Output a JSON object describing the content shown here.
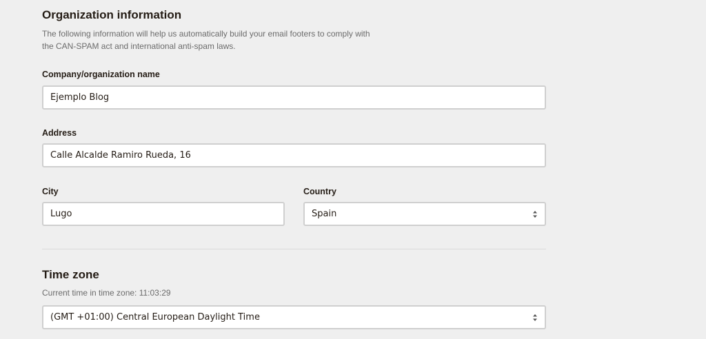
{
  "organization": {
    "title": "Organization information",
    "description": "The following information will help us automatically build your email footers to comply with the CAN-SPAM act and international anti-spam laws.",
    "company": {
      "label": "Company/organization name",
      "value": "Ejemplo Blog"
    },
    "address": {
      "label": "Address",
      "value": "Calle Alcalde Ramiro Rueda, 16"
    },
    "city": {
      "label": "City",
      "value": "Lugo"
    },
    "country": {
      "label": "Country",
      "value": "Spain"
    }
  },
  "timezone": {
    "title": "Time zone",
    "current_time": "Current time in time zone: 11:03:29",
    "value": "(GMT +01:00) Central European Daylight Time"
  },
  "icons": {
    "select_arrow": "up-down-chevron-icon"
  }
}
